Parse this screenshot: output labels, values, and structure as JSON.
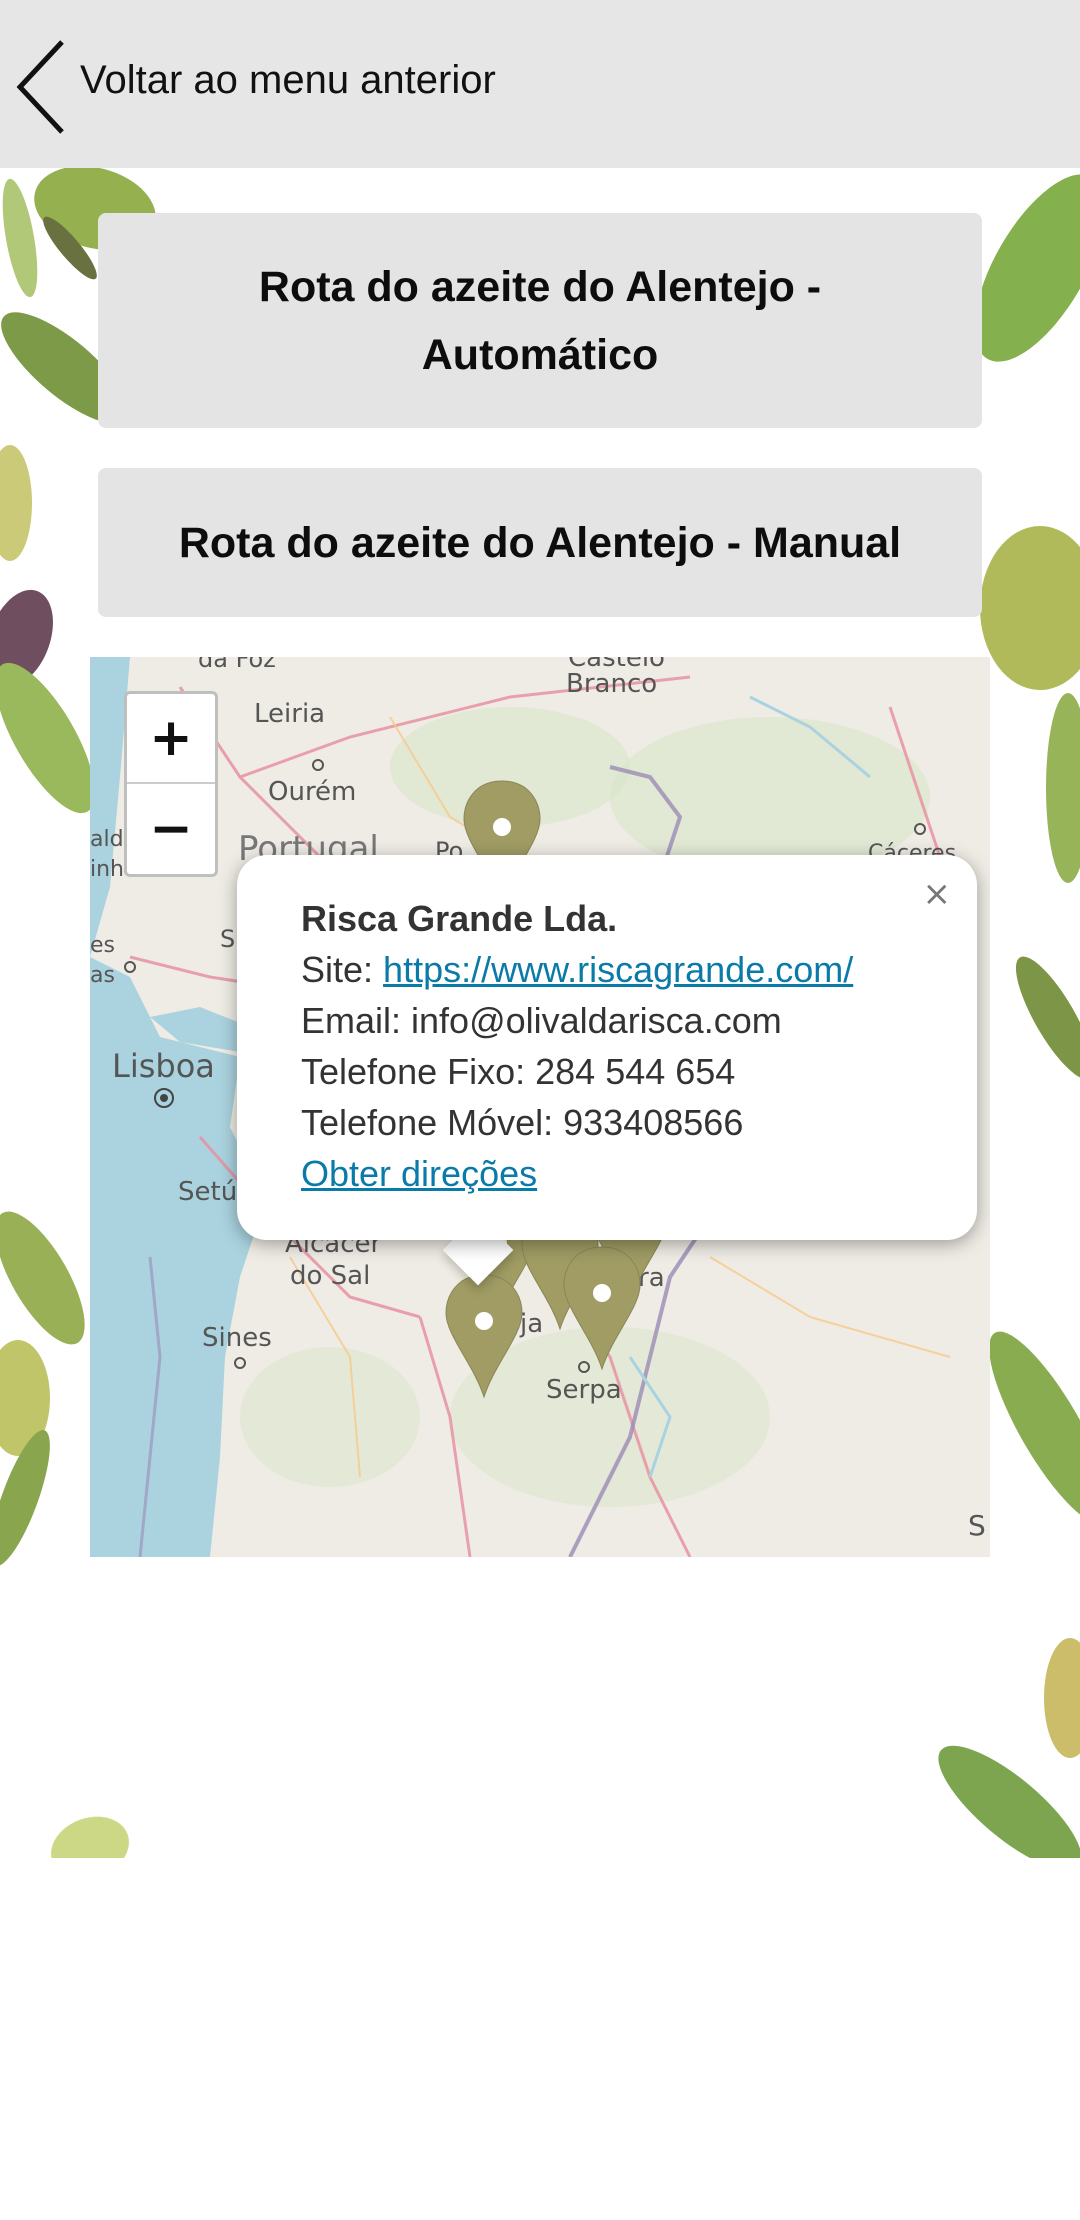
{
  "header": {
    "back_label": "Voltar ao menu anterior"
  },
  "routes": {
    "automatic_label": "Rota do azeite do Alentejo - Automático",
    "manual_label": "Rota do azeite do Alentejo - Manual"
  },
  "map": {
    "zoom_in": "+",
    "zoom_out": "−",
    "places": {
      "leiria": "Leiria",
      "ourem": "Ourém",
      "portugal": "Portugal",
      "castelo_branco_top": "Castelo",
      "castelo_branco": "Branco",
      "lisboa": "Lisboa",
      "setubal": "Setú",
      "alcacer_1": "Alcácer",
      "alcacer_2": "do Sal",
      "sines": "Sines",
      "serpa": "Serpa",
      "caceres": "Cáceres",
      "partial_ald": "ald",
      "partial_inha": "inha",
      "partial_es": "es",
      "partial_as": "as",
      "partial_ja": "ja",
      "partial_ra": "ra",
      "partial_po": "Po",
      "partial_s": "S",
      "partial_da_foz": "da Foz"
    },
    "marker_color": "#a09c64",
    "popup": {
      "close": "×",
      "name": "Risca Grande Lda.",
      "site_label": "Site: ",
      "site_url": "https://www.riscagrande.com/",
      "email": "Email: info@olivaldarisca.com",
      "phone_fixed": "Telefone Fixo: 284 544 654",
      "phone_mobile": "Telefone Móvel: 933408566",
      "directions": "Obter direções"
    }
  }
}
